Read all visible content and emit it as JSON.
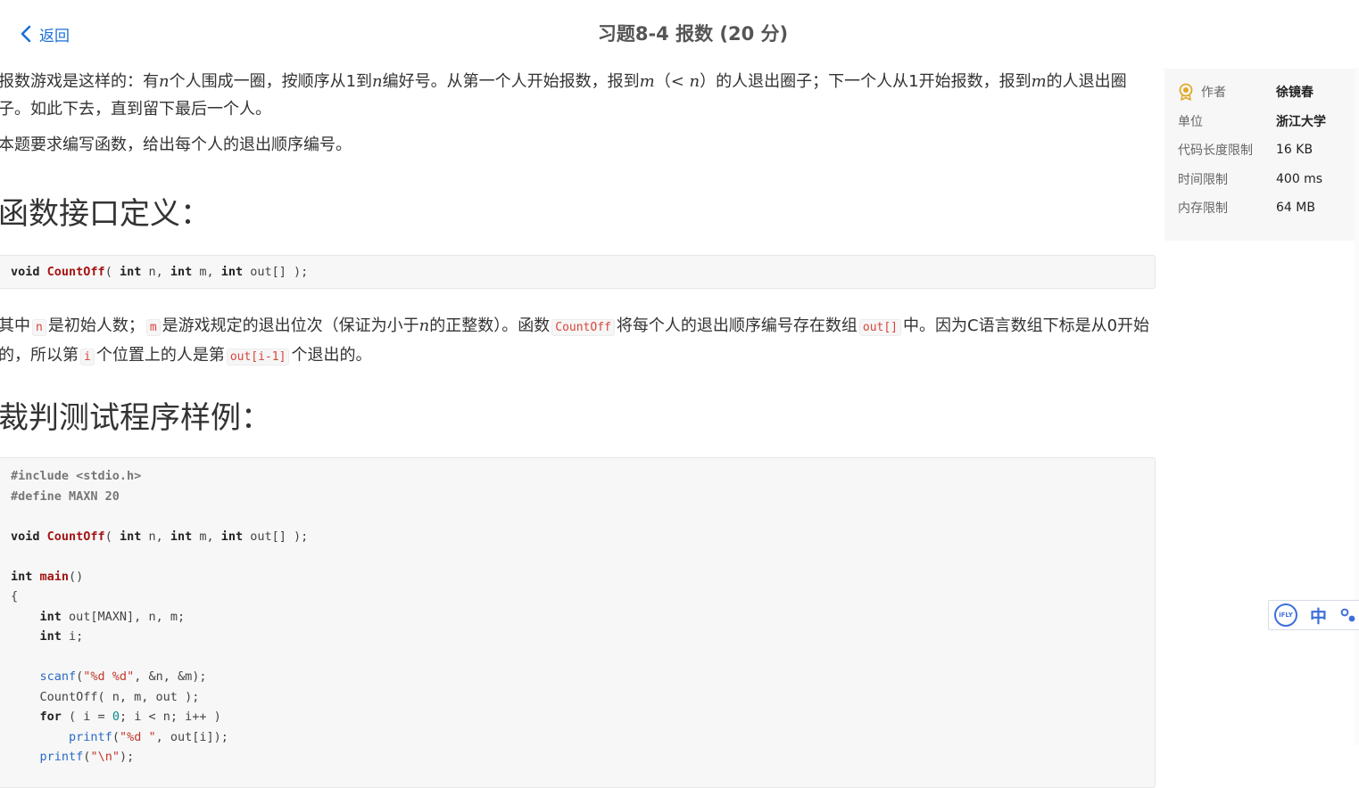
{
  "nav": {
    "back_label": "返回"
  },
  "header": {
    "title": "习题8-4 报数 (20 分)"
  },
  "problem": {
    "p1": {
      "t1": "报数游戏是这样的：有",
      "n1": "n",
      "t2": "个人围成一圈，按顺序从1到",
      "n2": "n",
      "t3": "编好号。从第一个人开始报数，报到",
      "m1": "m",
      "t4": "（",
      "lt": "<",
      "n3": "n",
      "t5": "）的人退出圈子；下一个人从1开始报数，报到",
      "m2": "m",
      "t6": "的人退出圈子。如此下去，直到留下最后一个人。"
    },
    "p2": "本题要求编写函数，给出每个人的退出顺序编号。",
    "section1_title": "函数接口定义：",
    "interface_code": {
      "kw_void": "void",
      "fn_name": "CountOff",
      "rest1": "( ",
      "kw_int1": "int",
      "rest2": " n, ",
      "kw_int2": "int",
      "rest3": " m, ",
      "kw_int3": "int",
      "rest4": " out[] );"
    },
    "p3": {
      "t1": "其中",
      "code_n": "n",
      "t2": "是初始人数；",
      "code_m": "m",
      "t3": "是游戏规定的退出位次（保证为小于",
      "n": "n",
      "t4": "的正整数）。函数",
      "code_fn": "CountOff",
      "t5": "将每个人的退出顺序编号存在数组",
      "code_out": "out[]",
      "t6": "中。因为C语言数组下标是从0开始的，所以第",
      "code_i": "i",
      "t7": "个位置上的人是第",
      "code_out_i": "out[i-1]",
      "t8": "个退出的。"
    },
    "section2_title": "裁判测试程序样例：",
    "sample": {
      "l1": "#include <stdio.h>",
      "l2": "#define MAXN 20",
      "l4_kw": "void",
      "l4_fn": "CountOff",
      "l4_a": "( ",
      "l4_int1": "int",
      "l4_b": " n, ",
      "l4_int2": "int",
      "l4_c": " m, ",
      "l4_int3": "int",
      "l4_d": " out[] );",
      "l6_kw": "int",
      "l6_sp": " ",
      "l6_fn": "main",
      "l6_rest": "()",
      "l7": "{",
      "l8_ind": "    ",
      "l8_kw": "int",
      "l8_rest": " out[MAXN], n, m;",
      "l9_ind": "    ",
      "l9_kw": "int",
      "l9_rest": " i;",
      "l11_ind": "    ",
      "l11_fn": "scanf",
      "l11_a": "(",
      "l11_str": "\"%d %d\"",
      "l11_b": ", &n, &m);",
      "l12": "    CountOff( n, m, out );",
      "l13_ind": "    ",
      "l13_kw": "for",
      "l13_a": " ( i = ",
      "l13_num": "0",
      "l13_b": "; i < n; i++ )",
      "l14_ind": "        ",
      "l14_fn": "printf",
      "l14_a": "(",
      "l14_str": "\"%d \"",
      "l14_b": ", out[i]);",
      "l15_ind": "    ",
      "l15_fn": "printf",
      "l15_a": "(",
      "l15_str": "\"\\n\"",
      "l15_b": ");"
    }
  },
  "sidebar": {
    "rows": [
      {
        "label": "作者",
        "value": "徐镜春"
      },
      {
        "label": "单位",
        "value": "浙江大学"
      },
      {
        "label": "代码长度限制",
        "value": "16 KB"
      },
      {
        "label": "时间限制",
        "value": "400 ms"
      },
      {
        "label": "内存限制",
        "value": "64 MB"
      }
    ]
  },
  "ime": {
    "logo_text": "iFLY",
    "mode": "中"
  },
  "colors": {
    "link": "#1a6fd8",
    "inline_code": "#d8453c",
    "ime_blue": "#3d6fd9",
    "author_icon": "#e0a92b"
  }
}
